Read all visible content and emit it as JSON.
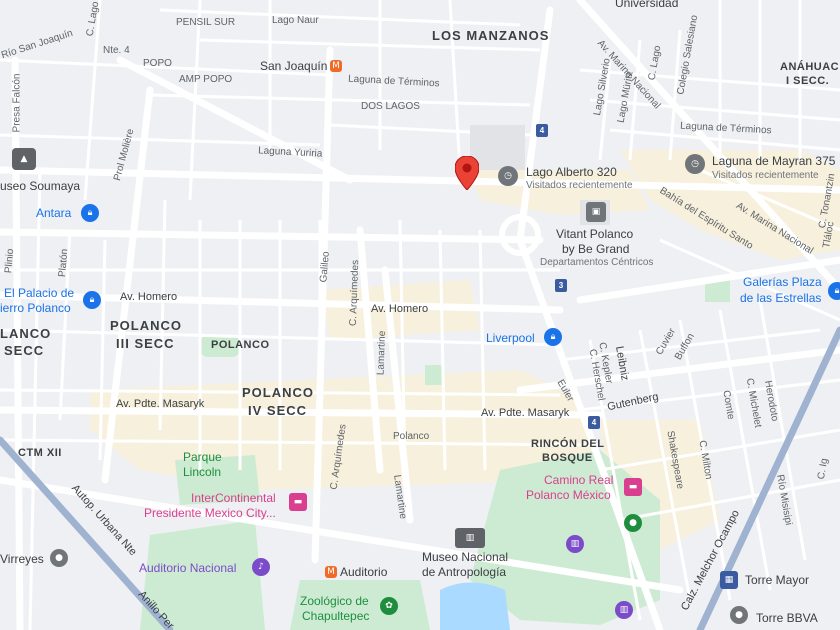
{
  "neighborhoods": {
    "los_manzanos": "LOS MANZANOS",
    "anahuac_1": "ANÁHUAC",
    "anahuac_2": "I SECC.",
    "polanco_3a": "POLANCO",
    "polanco_3b": "III SECC",
    "polanco_4a": "POLANCO",
    "polanco_4b": "IV SECC",
    "polanco_l": "POLANCO",
    "polanco_lw1": "LANCO",
    "polanco_lw2": "SECC",
    "ctm": "CTM XII",
    "rincon_1": "RINCÓN DEL",
    "rincon_2": "BOSQUE",
    "popo": "POPO",
    "amp_popo": "AMP POPO",
    "dos_lagos": "DOS LAGOS",
    "pensil_sur": "PENSIL SUR"
  },
  "roads": {
    "nte4": "Nte. 4",
    "lago_naur": "Lago Naur",
    "san_joaquin_rd": "Río San Joaquín",
    "laguna_terminos_1": "Laguna de Términos",
    "laguna_terminos_2": "Laguna de Términos",
    "laguna_yuriria": "Laguna Yuriria",
    "presa_falcon": "Presa Falcón",
    "prol_moliere": "Prol Molière",
    "av_marina_nacional_1": "Av. Marina Nacional",
    "av_marina_nacional_2": "Av. Marina Nacional",
    "av_homero_1": "Av. Homero",
    "av_homero_2": "Av. Homero",
    "av_masaryk_1": "Av. Pdte. Masaryk",
    "av_masaryk_2": "Av. Pdte. Masaryk",
    "c_arquimedes_1": "C. Arquímedes",
    "c_arquimedes_2": "C. Arquímedes",
    "lamartine_1": "Lamartine",
    "lamartine_2": "Lamartine",
    "galileo": "Galileo",
    "platon": "Platón",
    "plinio": "Plinio",
    "polanco_st": "Polanco",
    "leibniz": "Leibniz",
    "euler": "Euler",
    "gutenberg": "Gutenberg",
    "kepler": "C. Kepler",
    "herschel": "C. Herschel",
    "cuvier": "Cuvier",
    "buffon": "Buffon",
    "shakespeare": "Shakespeare",
    "milton": "C. Milton",
    "comte": "Comte",
    "michelet": "C. Michelet",
    "herodoto": "Herodoto",
    "rio_misisipi": "Río Misisipi",
    "calz_ocampo": "Calz. Melchor Ocampo",
    "autop_urbana": "Autop. Urbana Nte",
    "anillo_per": "Anillo Per",
    "bahia_espiritu": "Bahía del Espíritu Santo",
    "lago_silverio": "Lago Silverio",
    "lago_muritz": "Lago Müritz",
    "c_lago_1": "C. Lago",
    "c_lago_2": "C. Lago",
    "colegio_salesiano": "Colegio Salesiano",
    "c_tonantzin": "C. Tonantzin",
    "tlaloc": "Tláloc",
    "c_ig": "C. Ig"
  },
  "places": {
    "universidad": "Universidad",
    "san_joaquin": "San Joaquín",
    "lago_alberto": "Lago Alberto 320",
    "lago_alberto_sub": "Visitados recientemente",
    "laguna_mayran": "Laguna de Mayran 375",
    "laguna_mayran_sub": "Visitados recientemente",
    "vitant_1": "Vitant Polanco",
    "vitant_2": "by Be Grand",
    "vitant_sub": "Departamentos Céntricos",
    "museo_soumaya": "useo Soumaya",
    "antara": "Antara",
    "palacio_1": "El Palacio de",
    "palacio_2": "ierro Polanco",
    "liverpool": "Liverpool",
    "galerias_1": "Galerías Plaza",
    "galerias_2": "de las Estrellas",
    "parque_1": "Parque",
    "parque_2": "Lincoln",
    "intercontinental_1": "InterContinental",
    "intercontinental_2": "Presidente Mexico City...",
    "camino_real_1": "Camino Real",
    "camino_real_2": "Polanco México",
    "museo_antro_1": "Museo Nacional",
    "museo_antro_2": "de Antropología",
    "auditorio_nacional": "Auditorio Nacional",
    "auditorio_metro": "Auditorio",
    "zoologico_1": "Zoológico de",
    "zoologico_2": "Chapultepec",
    "virreyes": "Virreyes",
    "torre_mayor": "Torre Mayor",
    "torre_bbva": "Torre BBVA"
  },
  "route_shields": {
    "s1": "4",
    "s2": "3",
    "s3": "4"
  },
  "colors": {
    "pin": "#ea4335",
    "blue_poi": "#1a73e8",
    "pink_poi": "#d93f8e",
    "purple_poi": "#7b4bc9",
    "park": "#cdebd2",
    "water": "#aadaff",
    "highway": "#8fa7c9"
  }
}
